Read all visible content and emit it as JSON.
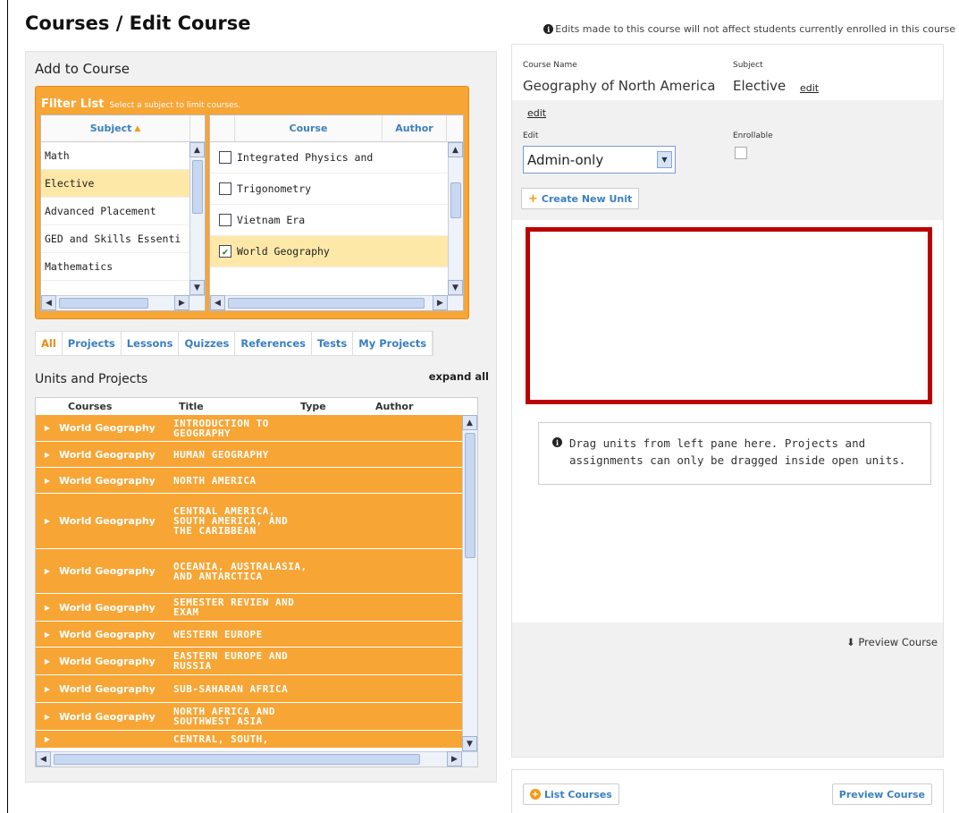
{
  "header": {
    "title": "Courses / Edit Course",
    "note": "Edits made to this course will not affect students currently enrolled in this course"
  },
  "left": {
    "heading": "Add to Course",
    "filter": {
      "title": "Filter List",
      "hint": "Select a subject to limit courses.",
      "subject_header": "Subject",
      "subjects": [
        "Math",
        "Elective",
        "Advanced Placement",
        "GED and  Skills Essenti",
        "Mathematics"
      ],
      "selected_subject_index": 1,
      "course_header": "Course",
      "author_header": "Author",
      "courses": [
        {
          "name": "Integrated Physics and",
          "checked": false
        },
        {
          "name": "Trigonometry",
          "checked": false
        },
        {
          "name": "Vietnam Era",
          "checked": false
        },
        {
          "name": "World Geography",
          "checked": true
        }
      ]
    },
    "tabs": [
      "All",
      "Projects",
      "Lessons",
      "Quizzes",
      "References",
      "Tests",
      "My Projects"
    ],
    "active_tab": "All",
    "units_heading": "Units and Projects",
    "expand_all": "expand all",
    "units_columns": [
      "Courses",
      "Title",
      "Type",
      "Author"
    ],
    "units": [
      {
        "course": "World Geography",
        "title": "INTRODUCTION TO GEOGRAPHY"
      },
      {
        "course": "World Geography",
        "title": "HUMAN GEOGRAPHY"
      },
      {
        "course": "World Geography",
        "title": "NORTH AMERICA"
      },
      {
        "course": "World Geography",
        "title": "CENTRAL AMERICA, SOUTH AMERICA, AND THE CARIBBEAN"
      },
      {
        "course": "World Geography",
        "title": "OCEANIA, AUSTRALASIA, AND ANTARCTICA"
      },
      {
        "course": "World Geography",
        "title": "SEMESTER REVIEW AND EXAM"
      },
      {
        "course": "World Geography",
        "title": "WESTERN EUROPE"
      },
      {
        "course": "World Geography",
        "title": "EASTERN EUROPE AND RUSSIA"
      },
      {
        "course": "World Geography",
        "title": "SUB-SAHARAN AFRICA"
      },
      {
        "course": "World Geography",
        "title": "NORTH AFRICA AND SOUTHWEST ASIA"
      },
      {
        "course": "",
        "title": "CENTRAL, SOUTH,"
      }
    ]
  },
  "right": {
    "course_name_label": "Course Name",
    "course_name": "Geography of North America",
    "subject_label": "Subject",
    "subject": "Elective",
    "edit_link": "edit",
    "edit_link_2": "edit",
    "edit_label": "Edit",
    "edit_value": "Admin-only",
    "enrollable_label": "Enrollable",
    "create_unit": "Create New Unit",
    "drag_note": "Drag units from left pane here. Projects and assignments can only be dragged inside open units.",
    "preview_link": "Preview Course"
  },
  "footer": {
    "list_courses": "List Courses",
    "preview_course": "Preview Course"
  },
  "colors": {
    "accent_orange": "#f7a534",
    "link_blue": "#3a7fc0",
    "highlight_red": "#bb0000"
  }
}
